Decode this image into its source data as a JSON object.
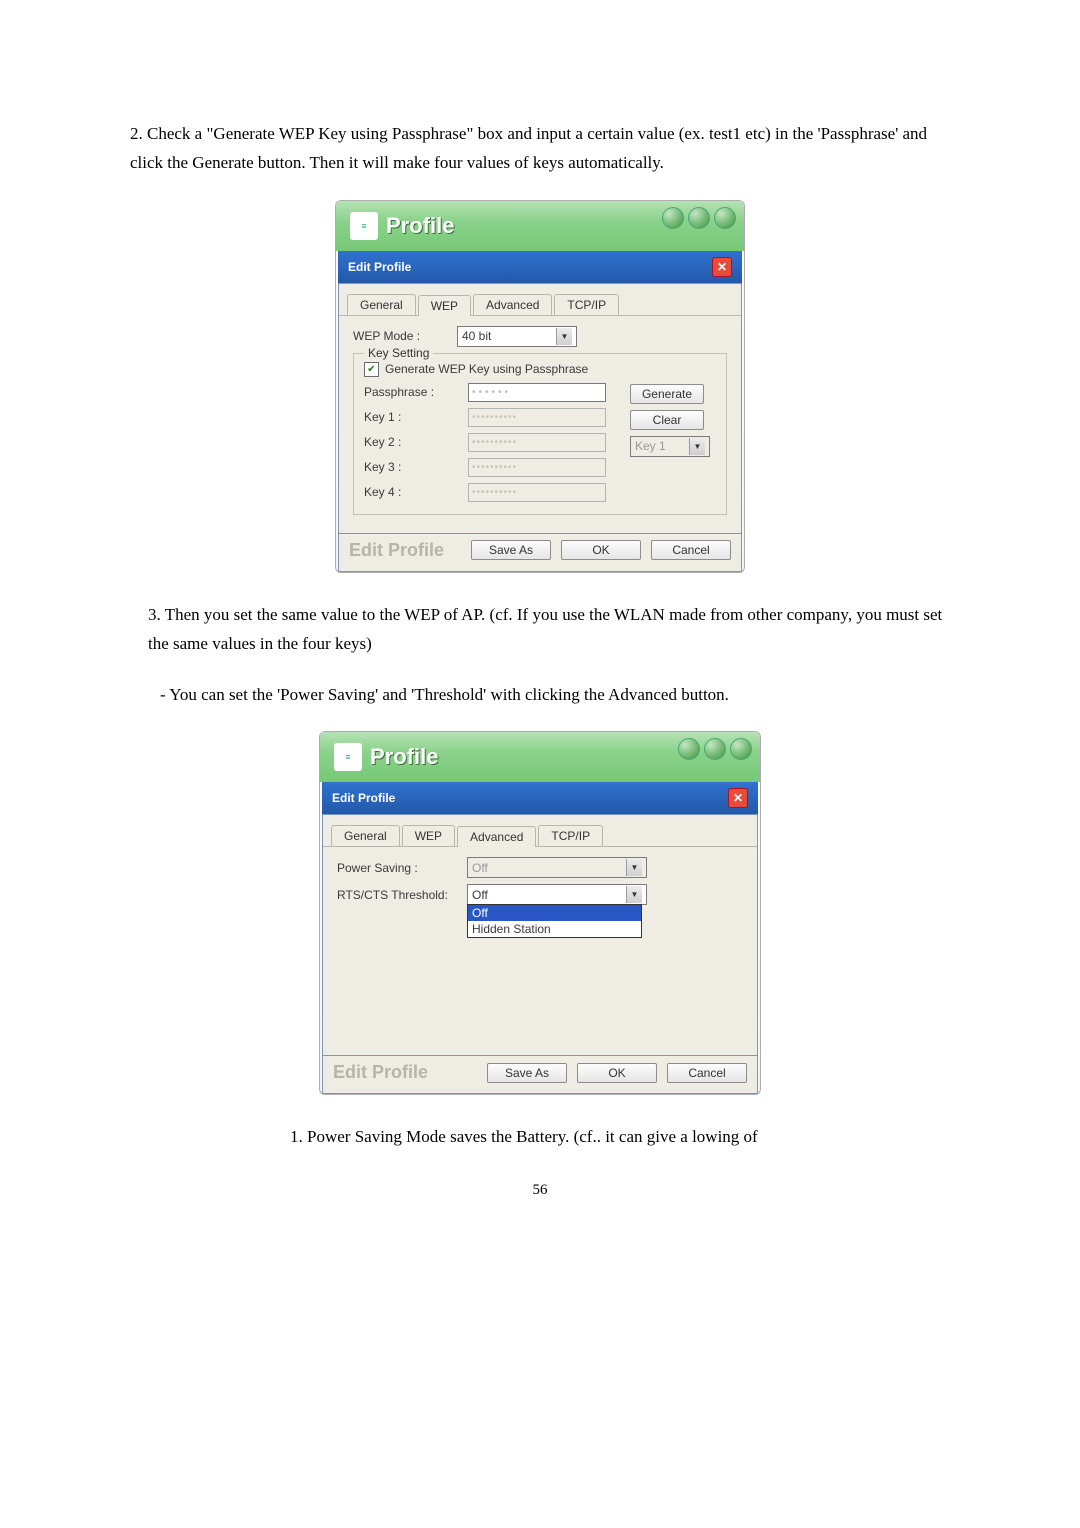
{
  "para1": "2. Check a \"Generate WEP Key using Passphrase\" box and input a certain value (ex. test1 etc) in the 'Passphrase' and click the Generate button. Then it will make four values of keys automatically.",
  "para2": "3. Then you set the same value to the WEP of AP. (cf. If  you use the WLAN  made from other company, you must set the same values in the four keys)",
  "para3": "-    You can set the 'Power Saving' and 'Threshold' with clicking the Advanced button.",
  "para4": "1.  Power Saving Mode saves the Battery. (cf.. it can  give a lowing of",
  "common": {
    "app_title": "Profile",
    "edit_title": "Edit Profile",
    "tabs": {
      "general": "General",
      "wep": "WEP",
      "advanced": "Advanced",
      "tcpip": "TCP/IP"
    },
    "footer_label": "Edit Profile",
    "save_as": "Save As",
    "ok": "OK",
    "cancel": "Cancel"
  },
  "wep": {
    "mode_label": "WEP Mode :",
    "mode_value": "40 bit",
    "keysetting_legend": "Key Setting",
    "gen_check_label": "Generate WEP Key using Passphrase",
    "passphrase_label": "Passphrase :",
    "passphrase_value": "••••••",
    "key1_label": "Key 1 :",
    "key2_label": "Key 2 :",
    "key3_label": "Key 3 :",
    "key4_label": "Key 4 :",
    "key_fill": "••••••••••",
    "generate_btn": "Generate",
    "clear_btn": "Clear",
    "keyn_sel": "Key 1"
  },
  "adv": {
    "ps_label": "Power Saving :",
    "ps_value": "Off",
    "rts_label": "RTS/CTS Threshold:",
    "rts_value": "Off",
    "opt1": "Off",
    "opt2": "Hidden Station"
  },
  "page_no": "56"
}
